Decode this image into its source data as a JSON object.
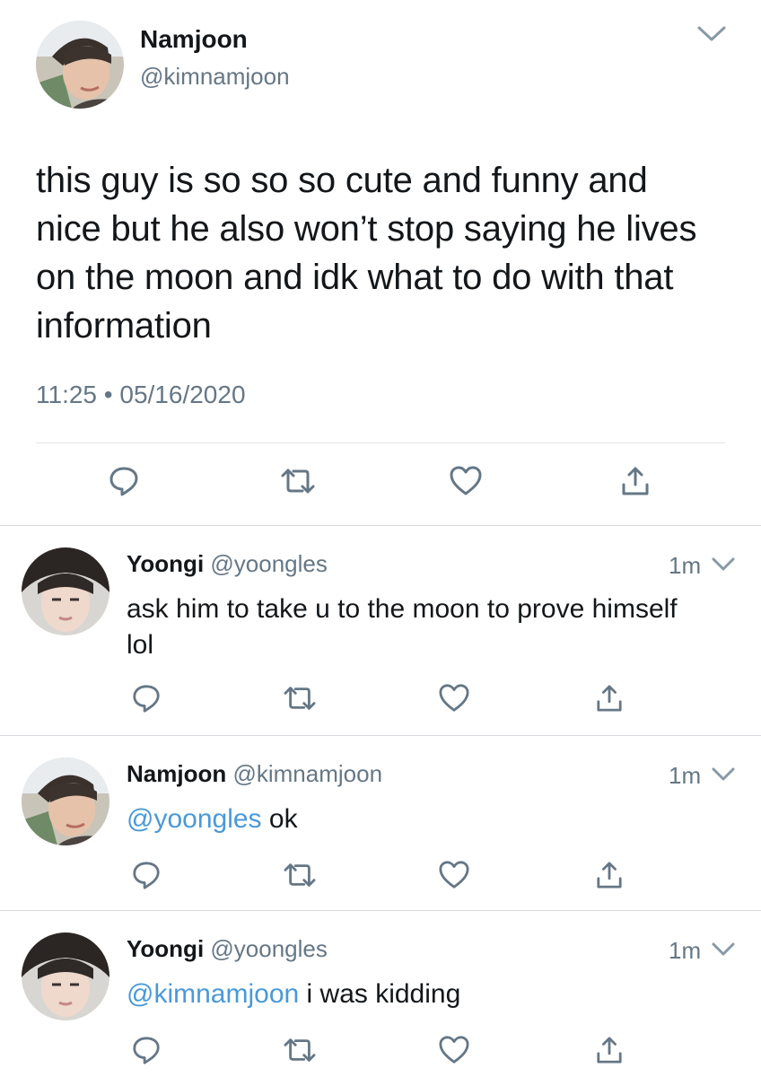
{
  "main_tweet": {
    "name": "Namjoon",
    "handle": "@kimnamjoon",
    "text": "this guy is so so so cute and funny and nice but he also won’t stop saying he lives on the moon and idk what to do with that information",
    "time": "11:25",
    "separator": "•",
    "date": "05/16/2020"
  },
  "replies": [
    {
      "name": "Yoongi",
      "handle": "@yoongles",
      "time": "1m",
      "mention": "",
      "text": "ask him to take u to the moon to prove himself lol"
    },
    {
      "name": "Namjoon",
      "handle": "@kimnamjoon",
      "time": "1m",
      "mention": "@yoongles",
      "text": " ok"
    },
    {
      "name": "Yoongi",
      "handle": "@yoongles",
      "time": "1m",
      "mention": "@kimnamjoon",
      "text": " i was kidding"
    }
  ],
  "icons": [
    "reply-icon",
    "retweet-icon",
    "like-icon",
    "share-icon",
    "chevron-down-icon"
  ],
  "colors": {
    "text": "#14171a",
    "secondary": "#657786",
    "link": "#4a99d8",
    "divider": "#d6dadf"
  }
}
